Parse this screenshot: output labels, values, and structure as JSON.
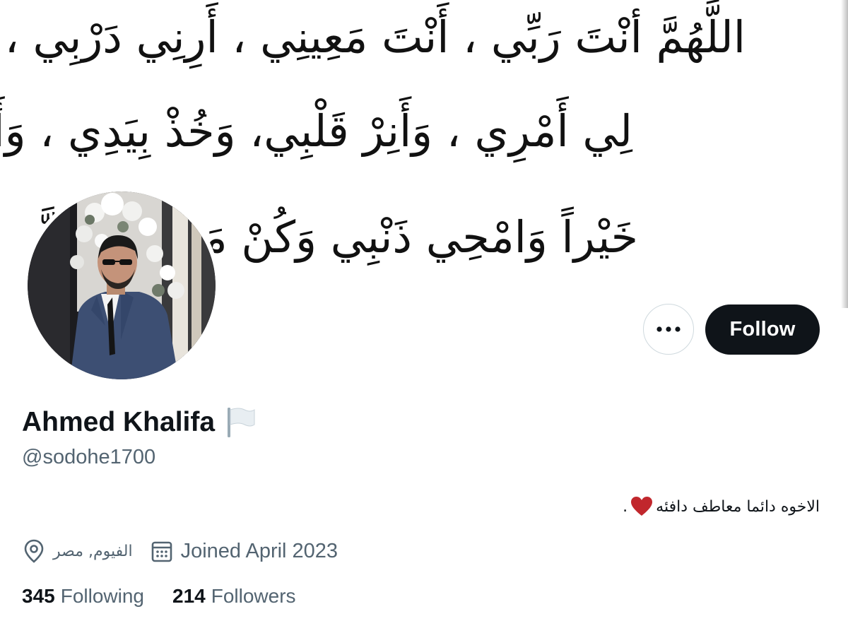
{
  "banner": {
    "lines": [
      "اللَّهُمَّ أنْتَ رَبِّي ، أَنْتَ مَعِينِي ، أَرِنِي دَرْبِي ، وَيَسِّرْ",
      "لِي أَمْرِي ، وَأَنِرْ قَلْبِي، وَخُذْ بِيَدِي ، وَأَخْتِرْ لِي",
      "خَيْراً وَامْحِي ذَنْبِي وَكُنْ مَعِي يَا اللَّ"
    ]
  },
  "profile": {
    "display_name": "Ahmed Khalifa",
    "name_emoji_icon": "white-flag-icon",
    "handle": "@sodohe1700",
    "bio": "الاخوه دائما معاطف دافئه",
    "bio_suffix": ".",
    "bio_emoji_icon": "red-heart-icon",
    "location": "الفيوم, مصر",
    "joined": "Joined April 2023"
  },
  "actions": {
    "more_icon": "more-options-icon",
    "follow_label": "Follow"
  },
  "stats": {
    "following_count": "345",
    "following_label": "Following",
    "followers_count": "214",
    "followers_label": "Followers"
  },
  "colors": {
    "text_primary": "#0f1419",
    "text_secondary": "#536471",
    "follow_bg": "#0f1419",
    "border": "#cfd9de",
    "heart": "#c1272d"
  }
}
